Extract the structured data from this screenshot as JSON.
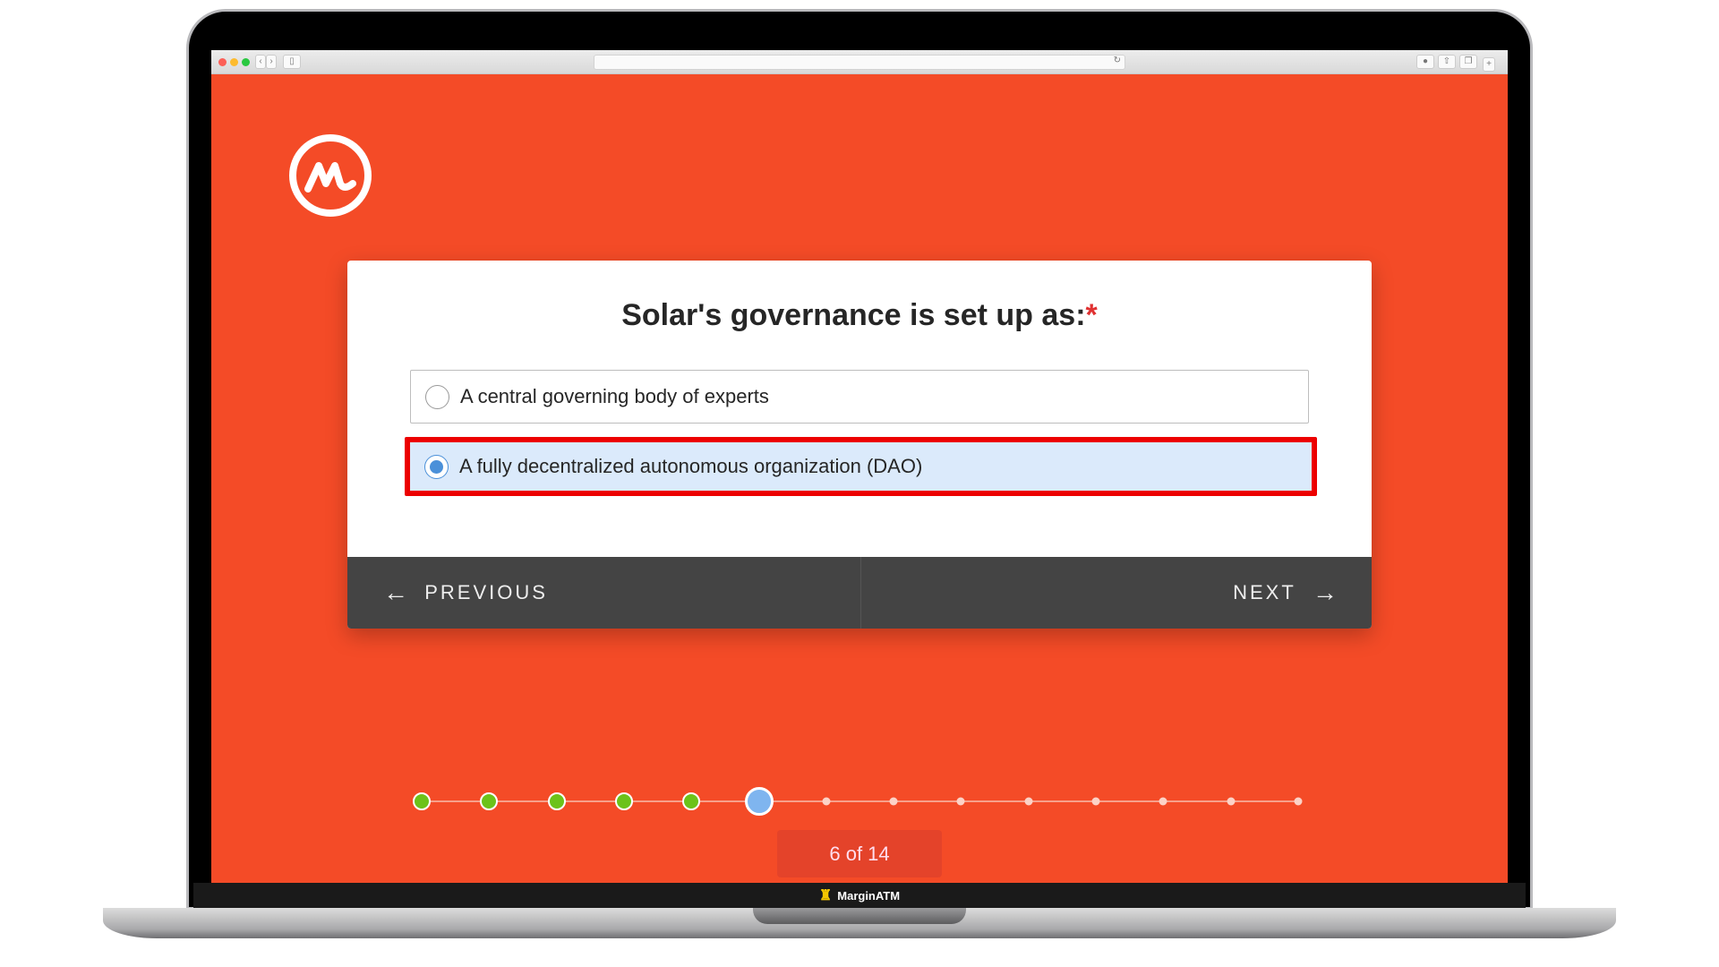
{
  "browser": {
    "back_icon": "chevron-left",
    "forward_icon": "chevron-right",
    "sidebar_icon": "sidebar",
    "reload_icon": "reload",
    "download_icon": "download",
    "share_icon": "share",
    "tabs_icon": "tabs",
    "new_tab_label": "+"
  },
  "brand": {
    "logo": "coinmarketcap-logo",
    "color": "#f44b27"
  },
  "question": {
    "title": "Solar's governance is set up as:",
    "required_mark": "*",
    "options": [
      {
        "label": "A central governing body of experts",
        "selected": false
      },
      {
        "label": "A fully decentralized autonomous organization (DAO)",
        "selected": true
      }
    ]
  },
  "nav": {
    "previous_label": "PREVIOUS",
    "next_label": "NEXT",
    "prev_arrow": "←",
    "next_arrow": "→"
  },
  "progress": {
    "current": 6,
    "total": 14,
    "completed": 5,
    "label": "6 of 14"
  },
  "taskbar": {
    "label": "MarginATM"
  }
}
